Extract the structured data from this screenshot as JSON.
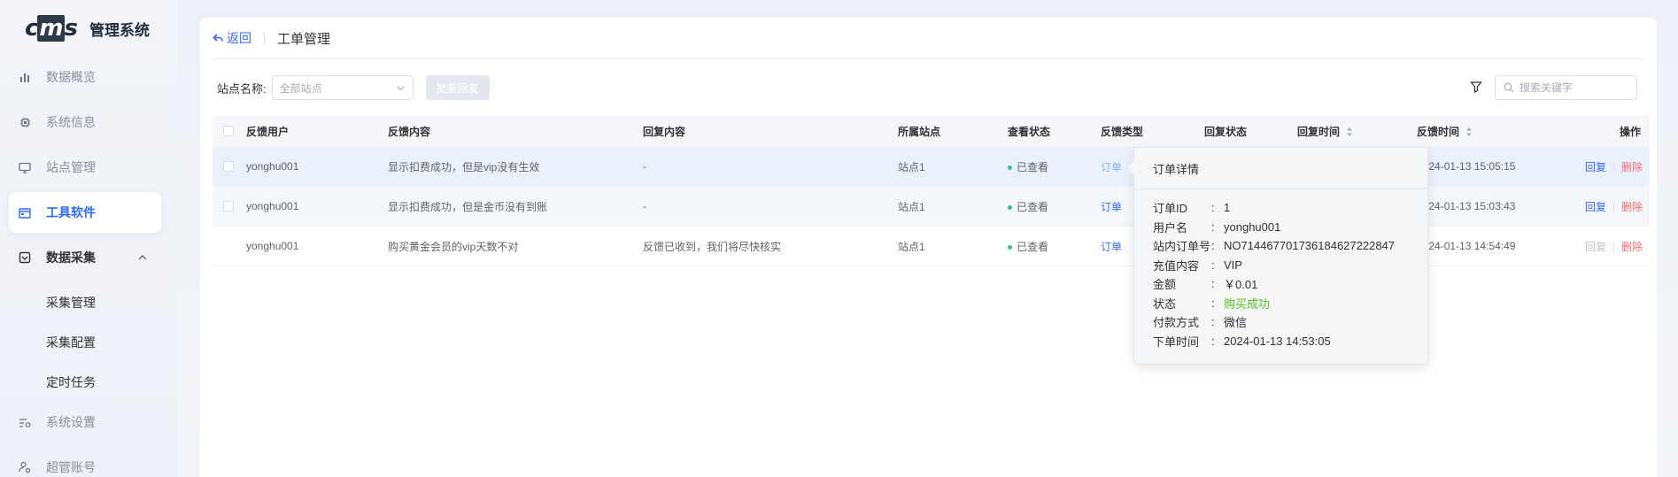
{
  "app": {
    "logo_text": "cms",
    "title": "管理系统"
  },
  "sidebar": {
    "items": [
      {
        "label": "数据概览",
        "icon": "bar-chart-icon"
      },
      {
        "label": "系统信息",
        "icon": "chip-icon"
      },
      {
        "label": "站点管理",
        "icon": "monitor-icon"
      },
      {
        "label": "工具软件",
        "icon": "toolbox-icon",
        "active": true
      },
      {
        "label": "数据采集",
        "icon": "collect-icon",
        "expanded": true
      },
      {
        "label": "系统设置",
        "icon": "settings-sliders-icon"
      },
      {
        "label": "超管账号",
        "icon": "user-gear-icon"
      }
    ],
    "submenu": [
      "采集管理",
      "采集配置",
      "定时任务"
    ]
  },
  "header": {
    "back_label": "返回",
    "title": "工单管理"
  },
  "filter": {
    "site_label": "站点名称:",
    "site_placeholder": "全部站点",
    "batch_reply_label": "批量回复",
    "search_placeholder": "搜索关键字"
  },
  "table": {
    "columns": {
      "user": "反馈用户",
      "feedback": "反馈内容",
      "reply": "回复内容",
      "site": "所属站点",
      "view_status": "查看状态",
      "type": "反馈类型",
      "reply_status": "回复状态",
      "reply_time": "回复时间",
      "feedback_time": "反馈时间",
      "actions": "操作"
    },
    "rows": [
      {
        "user": "yonghu001",
        "feedback": "显示扣费成功，但是vip没有生效",
        "reply": "-",
        "site": "站点1",
        "view_status": "已查看",
        "type": "订单",
        "feedback_time": "2024-01-13 15:05:15",
        "reply_action": "回复",
        "delete_action": "删除"
      },
      {
        "user": "yonghu001",
        "feedback": "显示扣费成功，但是金币没有到账",
        "reply": "-",
        "site": "站点1",
        "view_status": "已查看",
        "type": "订单",
        "feedback_time": "2024-01-13 15:03:43",
        "reply_action": "回复",
        "delete_action": "删除"
      },
      {
        "user": "yonghu001",
        "feedback": "购买黄金会员的vip天数不对",
        "reply": "反馈已收到，我们将尽快核实",
        "site": "站点1",
        "view_status": "已查看",
        "type": "订单",
        "feedback_time": "2024-01-13 14:54:49",
        "reply_action": "回复",
        "delete_action": "删除"
      }
    ]
  },
  "popover": {
    "title": "订单详情",
    "fields": [
      {
        "key": "订单ID",
        "value": "1"
      },
      {
        "key": "用户名",
        "value": "yonghu001"
      },
      {
        "key": "站内订单号",
        "value": "NO7144677017361846272228​47"
      },
      {
        "key": "充值内容",
        "value": "VIP"
      },
      {
        "key": "金额",
        "value": "￥0.01"
      },
      {
        "key": "状态",
        "value": "购买成功"
      },
      {
        "key": "付款方式",
        "value": "微信"
      },
      {
        "key": "下单时间",
        "value": "2024-01-13 14:53:05"
      }
    ],
    "colors": {
      "success": "#52c41a"
    }
  },
  "colors": {
    "primary": "#2f6bff",
    "danger": "#f56c6c",
    "viewed_dot": "#36c08a"
  }
}
